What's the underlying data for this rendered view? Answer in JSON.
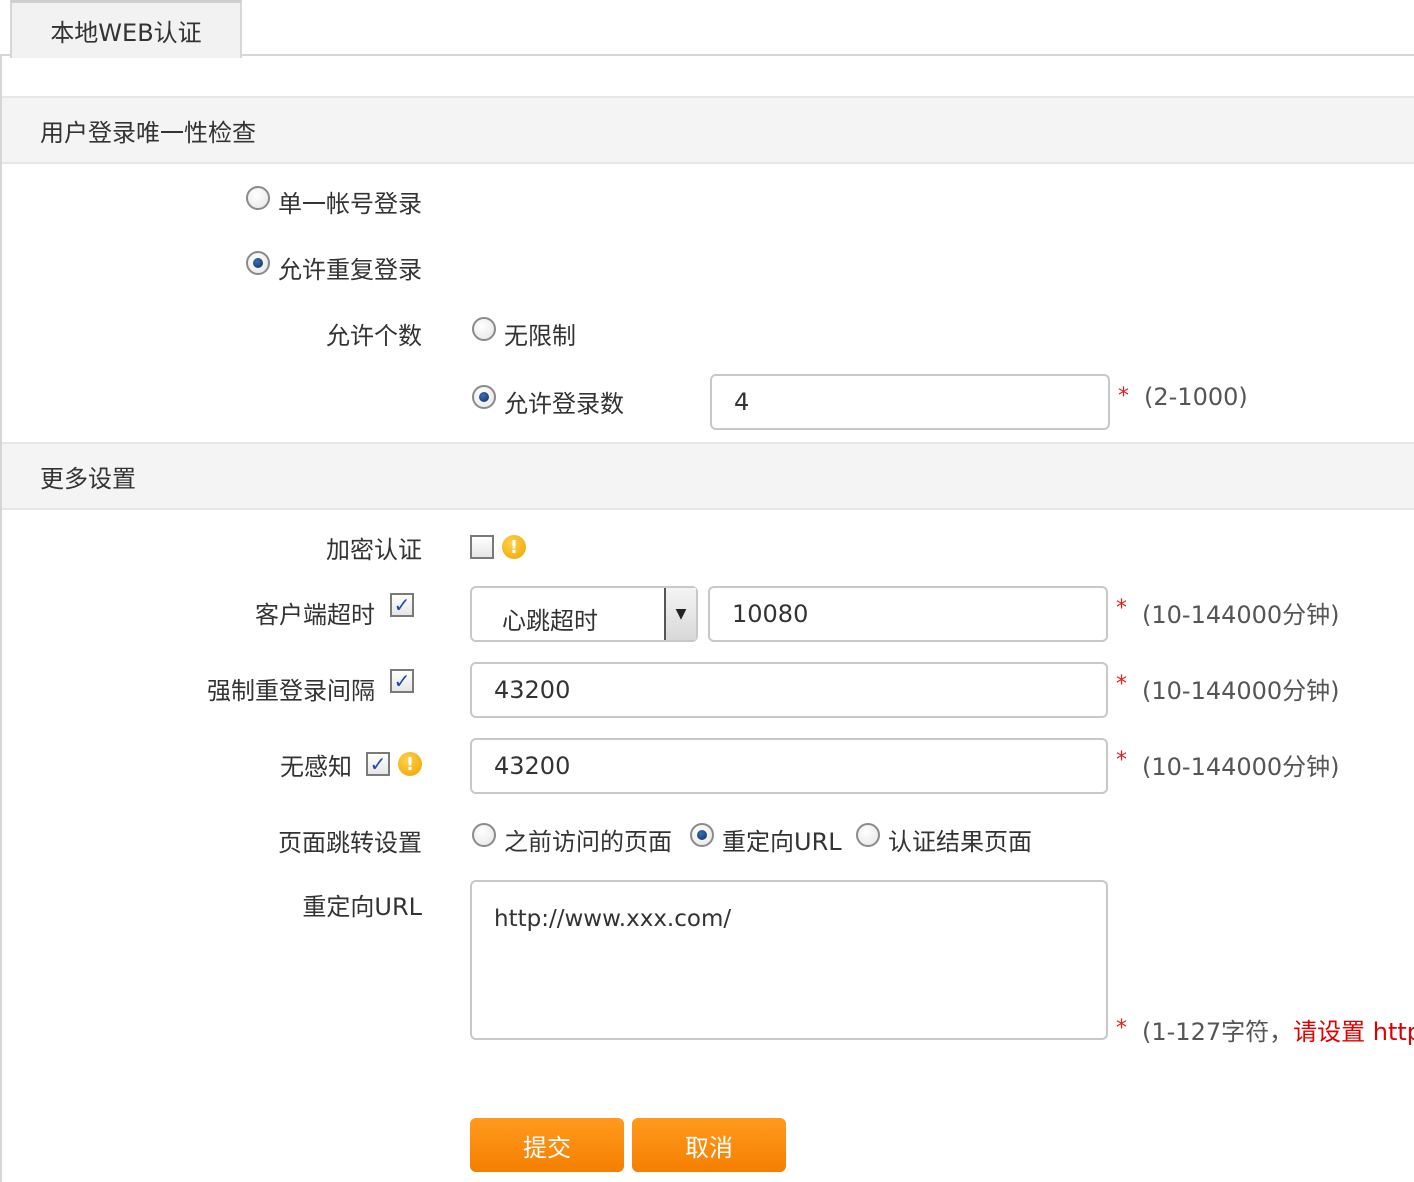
{
  "tab": {
    "label": "本地WEB认证"
  },
  "sections": {
    "login_check": "用户登录唯一性检查",
    "more_settings": "更多设置"
  },
  "login_check": {
    "single_login_label": "单一帐号登录",
    "single_login_checked": false,
    "allow_repeat_label": "允许重复登录",
    "allow_repeat_checked": true,
    "allow_count_label": "允许个数",
    "unlimited_label": "无限制",
    "unlimited_checked": false,
    "allow_num_label": "允许登录数",
    "allow_num_checked": true,
    "allow_num_value": "4",
    "allow_num_required": "*",
    "allow_num_range": "(2-1000)"
  },
  "more": {
    "encrypt_label": "加密认证",
    "encrypt_checked": false,
    "client_timeout_label": "客户端超时",
    "client_timeout_checked": true,
    "client_timeout_mode": "心跳超时",
    "client_timeout_value": "10080",
    "client_timeout_required": "*",
    "client_timeout_range": "(10-144000分钟)",
    "force_relogin_label": "强制重登录间隔",
    "force_relogin_checked": true,
    "force_relogin_value": "43200",
    "force_relogin_required": "*",
    "force_relogin_range": "(10-144000分钟)",
    "seamless_label": "无感知",
    "seamless_checked": true,
    "seamless_value": "43200",
    "seamless_required": "*",
    "seamless_range": "(10-144000分钟)",
    "redirect_setting_label": "页面跳转设置",
    "redirect_options": [
      "之前访问的页面",
      "重定向URL",
      "认证结果页面"
    ],
    "redirect_selected_index": 1,
    "redirect_url_label": "重定向URL",
    "redirect_url_value": "http://www.xxx.com/",
    "redirect_url_required": "*",
    "redirect_url_hint": "(1-127字符，",
    "redirect_url_hint_red": "请设置 http"
  },
  "buttons": {
    "submit": "提交",
    "cancel": "取消"
  },
  "colors": {
    "accent": "#f57f00",
    "required": "#e02020",
    "check": "#1f4aa8"
  },
  "icons": {
    "warning": "warning-icon",
    "dropdown": "chevron-down-icon"
  }
}
